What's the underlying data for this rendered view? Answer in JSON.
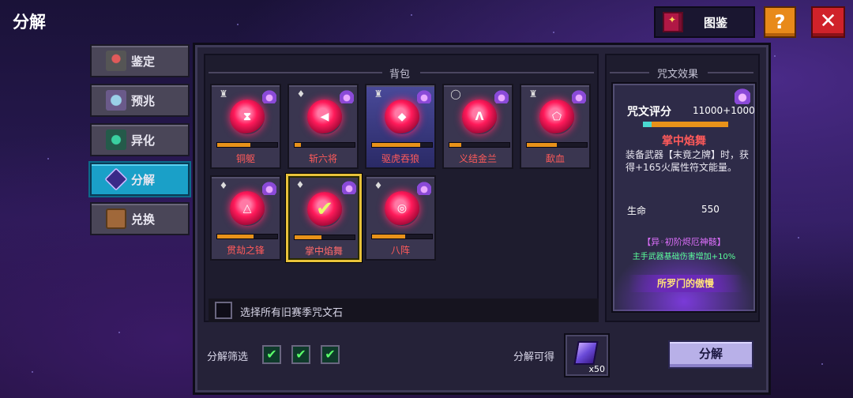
{
  "title": "分解",
  "top_bar": {
    "atlas_label": "图鉴",
    "help_symbol": "?",
    "close_symbol": "✕",
    "colors": {
      "help": "#e88a1a",
      "close": "#d0222a"
    }
  },
  "tabs": [
    {
      "label": "鉴定",
      "icon": "appraise-icon",
      "active": false
    },
    {
      "label": "预兆",
      "icon": "omen-orb-icon",
      "active": false
    },
    {
      "label": "异化",
      "icon": "mutation-icon",
      "active": false
    },
    {
      "label": "分解",
      "icon": "decompose-crystal-icon",
      "active": true
    },
    {
      "label": "兑换",
      "icon": "exchange-chest-icon",
      "active": false
    }
  ],
  "bag": {
    "title": "背包",
    "items": [
      {
        "name": "铜躯",
        "glyph": "⧗",
        "progress": 0.55
      },
      {
        "name": "斩六将",
        "glyph": "◀",
        "progress": 0.1
      },
      {
        "name": "驱虎吞狼",
        "glyph": "◆",
        "progress": 0.8
      },
      {
        "name": "义结金兰",
        "glyph": "ᐱ",
        "progress": 0.2
      },
      {
        "name": "歃血",
        "glyph": "⬠",
        "progress": 0.5
      },
      {
        "name": "贯劫之锋",
        "glyph": "△",
        "progress": 0.6
      },
      {
        "name": "掌中焰舞",
        "glyph": "✔",
        "progress": 0.45,
        "selected": true
      },
      {
        "name": "八阵",
        "glyph": "◎",
        "progress": 0.55
      }
    ],
    "select_all_label": "选择所有旧赛季咒文石"
  },
  "filter": {
    "label": "分解筛选",
    "checks": [
      "✔",
      "✔",
      "✔"
    ],
    "check_color": "#5aff6a"
  },
  "obtain": {
    "label": "分解可得",
    "item_icon": "crystal-fragment-icon",
    "quantity": "x50"
  },
  "decompose_button": "分解",
  "effect": {
    "section_title": "咒文效果",
    "score_label": "咒文评分",
    "score_value": "11000+1000",
    "rune_name": "掌中焰舞",
    "description": "装备武器【末竟之牌】时，获得+165火属性符文能量。",
    "stat_name": "生命",
    "stat_value": "550",
    "set_name": "【异◦初阶烬厄神骸】",
    "set_bonus": "主手武器基础伤害增加+10%",
    "set_banner": "所罗门的傲慢",
    "rune_name_color": "#ff5a5a"
  }
}
